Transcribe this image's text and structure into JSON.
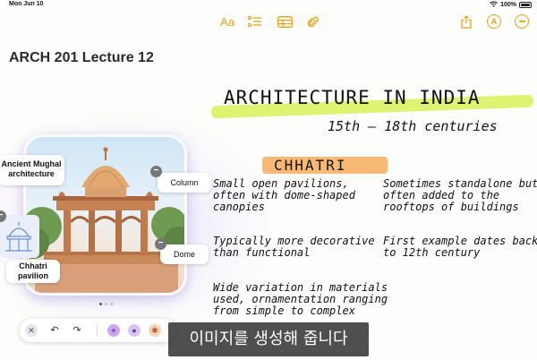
{
  "status": {
    "time": "Mon Jun 10",
    "battery": "100%"
  },
  "toolbar": {
    "format_label": "Aa",
    "icons": [
      "checklist-icon",
      "table-icon",
      "paperclip-icon",
      "share-icon",
      "markup-icon",
      "more-icon"
    ]
  },
  "note": {
    "title": "ARCH 201 Lecture 12",
    "heading": "ARCHITECTURE IN INDIA",
    "centuries": "15th – 18th centuries",
    "subheading": "CHHATRI",
    "bullets_left": [
      "Small open pavilions, often with dome-shaped canopies",
      "Typically more decorative than functional",
      "Wide variation in materials used, ornamentation ranging from simple to complex"
    ],
    "bullets_right": [
      "Sometimes standalone but often added to the rooftops of buildings",
      "First example dates back to 12th century"
    ]
  },
  "image_playground": {
    "labels": {
      "mughal": "Ancient Mughal architecture",
      "column": "Column",
      "dome": "Dome",
      "chhatri": "Chhatri pavilion"
    },
    "page_indicator": {
      "current": 1,
      "total": 3
    },
    "bottom_bar_icons": [
      "close-icon",
      "undo-icon",
      "redo-icon",
      "add-icon",
      "person-icon",
      "style-icon"
    ]
  },
  "toast": {
    "text": "이미지를 생성해 줍니다"
  },
  "colors": {
    "accent": "#e3a21a",
    "highlight_green": "#d2f046",
    "highlight_orange": "#f6ad5a"
  }
}
